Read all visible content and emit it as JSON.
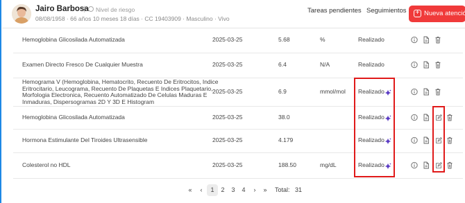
{
  "patient": {
    "name": "Jairo Barbosa",
    "risk_label": "Nivel de riesgo",
    "meta": "08/08/1958 · 66 años 10 meses 18 días · CC 19403909 · Masculino · Vivo"
  },
  "header_actions": {
    "pending": "Tareas pendientes",
    "followups": "Seguimientos",
    "new_attention": "Nueva atención"
  },
  "rows": [
    {
      "name": "Hemoglobina Glicosilada Automatizada",
      "date": "2025-03-25",
      "value": "5.68",
      "unit": "%",
      "status": "Realizado",
      "spark": false,
      "edit": false
    },
    {
      "name": "Examen Directo Fresco De Cualquier Muestra",
      "date": "2025-03-25",
      "value": "6.4",
      "unit": "N/A",
      "status": "Realizado",
      "spark": false,
      "edit": false
    },
    {
      "name_lines": [
        "Hemograma V (Hemoglobina, Hematocrito, Recuento De Eritrocitos, Indice",
        "Eritrocitario, Leucograma, Recuento De Plaquetas E Indices Plaquetario,",
        "Morfologia Electronica, Recuento Automatizado De Celulas Maduras E",
        "Inmaduras, Dispersogramas 2D Y 3D E Histogram"
      ],
      "date": "2025-03-25",
      "value": "6.9",
      "unit": "mmol/mol",
      "status": "Realizado",
      "spark": true,
      "edit": false
    },
    {
      "name": "Hemoglobina Glicosilada Automatizada",
      "date": "2025-03-25",
      "value": "38.0",
      "unit": "",
      "status": "Realizado",
      "spark": true,
      "edit": true
    },
    {
      "name": "Hormona Estimulante Del Tiroides Ultrasensible",
      "date": "2025-03-25",
      "value": "4.179",
      "unit": "",
      "status": "Realizado",
      "spark": true,
      "edit": true
    },
    {
      "name": "Colesterol no HDL",
      "date": "2025-03-25",
      "value": "188.50",
      "unit": "mg/dL",
      "status": "Realizado",
      "spark": true,
      "edit": true
    }
  ],
  "pagination": {
    "pages": [
      "1",
      "2",
      "3",
      "4"
    ],
    "current": "1",
    "total_label": "Total:",
    "total": "31"
  },
  "colors": {
    "accent_red": "#f03a3a",
    "highlight": "#e01919",
    "sparkle": "#5b3cc4",
    "left_border": "#1e88e5"
  }
}
